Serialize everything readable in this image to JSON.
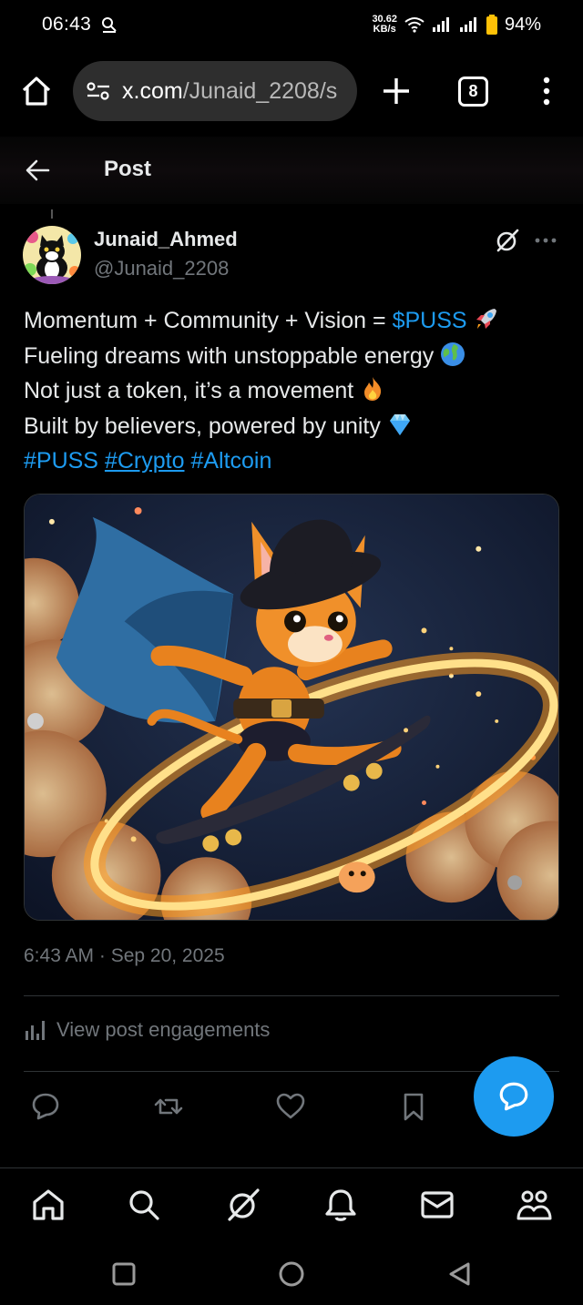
{
  "status_bar": {
    "time": "06:43",
    "net_speed_value": "30.62",
    "net_speed_unit": "KB/s",
    "battery": "94%"
  },
  "browser": {
    "url_host": "x.com",
    "url_path": "/Junaid_2208/s",
    "tab_count": "8"
  },
  "header": {
    "title": "Post"
  },
  "author": {
    "name": "Junaid_Ahmed",
    "handle": "@Junaid_2208"
  },
  "post": {
    "line1_text": "Momentum + Community + Vision = ",
    "line1_cashtag": "$PUSS",
    "line2_text": "Fueling dreams with unstoppable energy",
    "line3_text": "Not just a token, it’s a movement",
    "line4_text": "Built by believers, powered by unity",
    "hashtags": [
      "#PUSS",
      "#Crypto",
      "#Altcoin"
    ],
    "timestamp": "6:43 AM · Sep 20, 2025"
  },
  "engagements": {
    "label": "View post engagements"
  },
  "icons": {
    "home": "home-icon",
    "search": "search-icon",
    "grok": "grok-icon",
    "notifications": "bell-icon",
    "messages": "mail-icon",
    "communities": "people-icon"
  },
  "colors": {
    "accent": "#1d9bf0",
    "muted": "#71767b",
    "text": "#e7e9ea",
    "background": "#000000"
  }
}
